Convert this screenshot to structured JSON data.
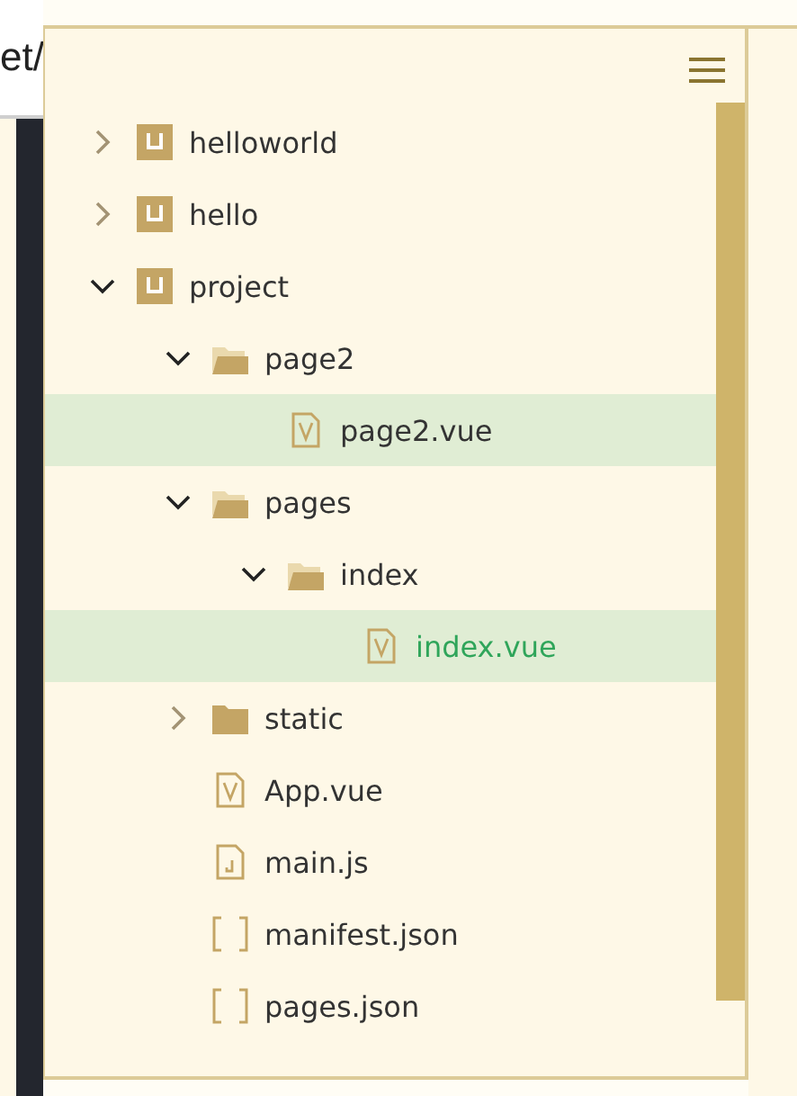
{
  "background_window": {
    "text": "et/"
  },
  "explorer": {
    "tree": [
      {
        "name": "helloworld",
        "kind": "project",
        "expanded": false,
        "selected": false,
        "current": false
      },
      {
        "name": "hello",
        "kind": "project",
        "expanded": false,
        "selected": false,
        "current": false
      },
      {
        "name": "project",
        "kind": "project",
        "expanded": true,
        "selected": false,
        "current": false,
        "children": [
          {
            "name": "page2",
            "kind": "folder",
            "expanded": true,
            "selected": false,
            "current": false,
            "children": [
              {
                "name": "page2.vue",
                "kind": "vue",
                "selected": true,
                "current": false
              }
            ]
          },
          {
            "name": "pages",
            "kind": "folder",
            "expanded": true,
            "selected": false,
            "current": false,
            "children": [
              {
                "name": "index",
                "kind": "folder",
                "expanded": true,
                "selected": false,
                "current": false,
                "children": [
                  {
                    "name": "index.vue",
                    "kind": "vue",
                    "selected": true,
                    "current": true
                  }
                ]
              }
            ]
          },
          {
            "name": "static",
            "kind": "folder",
            "expanded": false,
            "selected": false,
            "current": false
          },
          {
            "name": "App.vue",
            "kind": "vue",
            "selected": false,
            "current": false
          },
          {
            "name": "main.js",
            "kind": "js",
            "selected": false,
            "current": false
          },
          {
            "name": "manifest.json",
            "kind": "json",
            "selected": false,
            "current": false
          },
          {
            "name": "pages.json",
            "kind": "json",
            "selected": false,
            "current": false
          }
        ]
      }
    ]
  }
}
